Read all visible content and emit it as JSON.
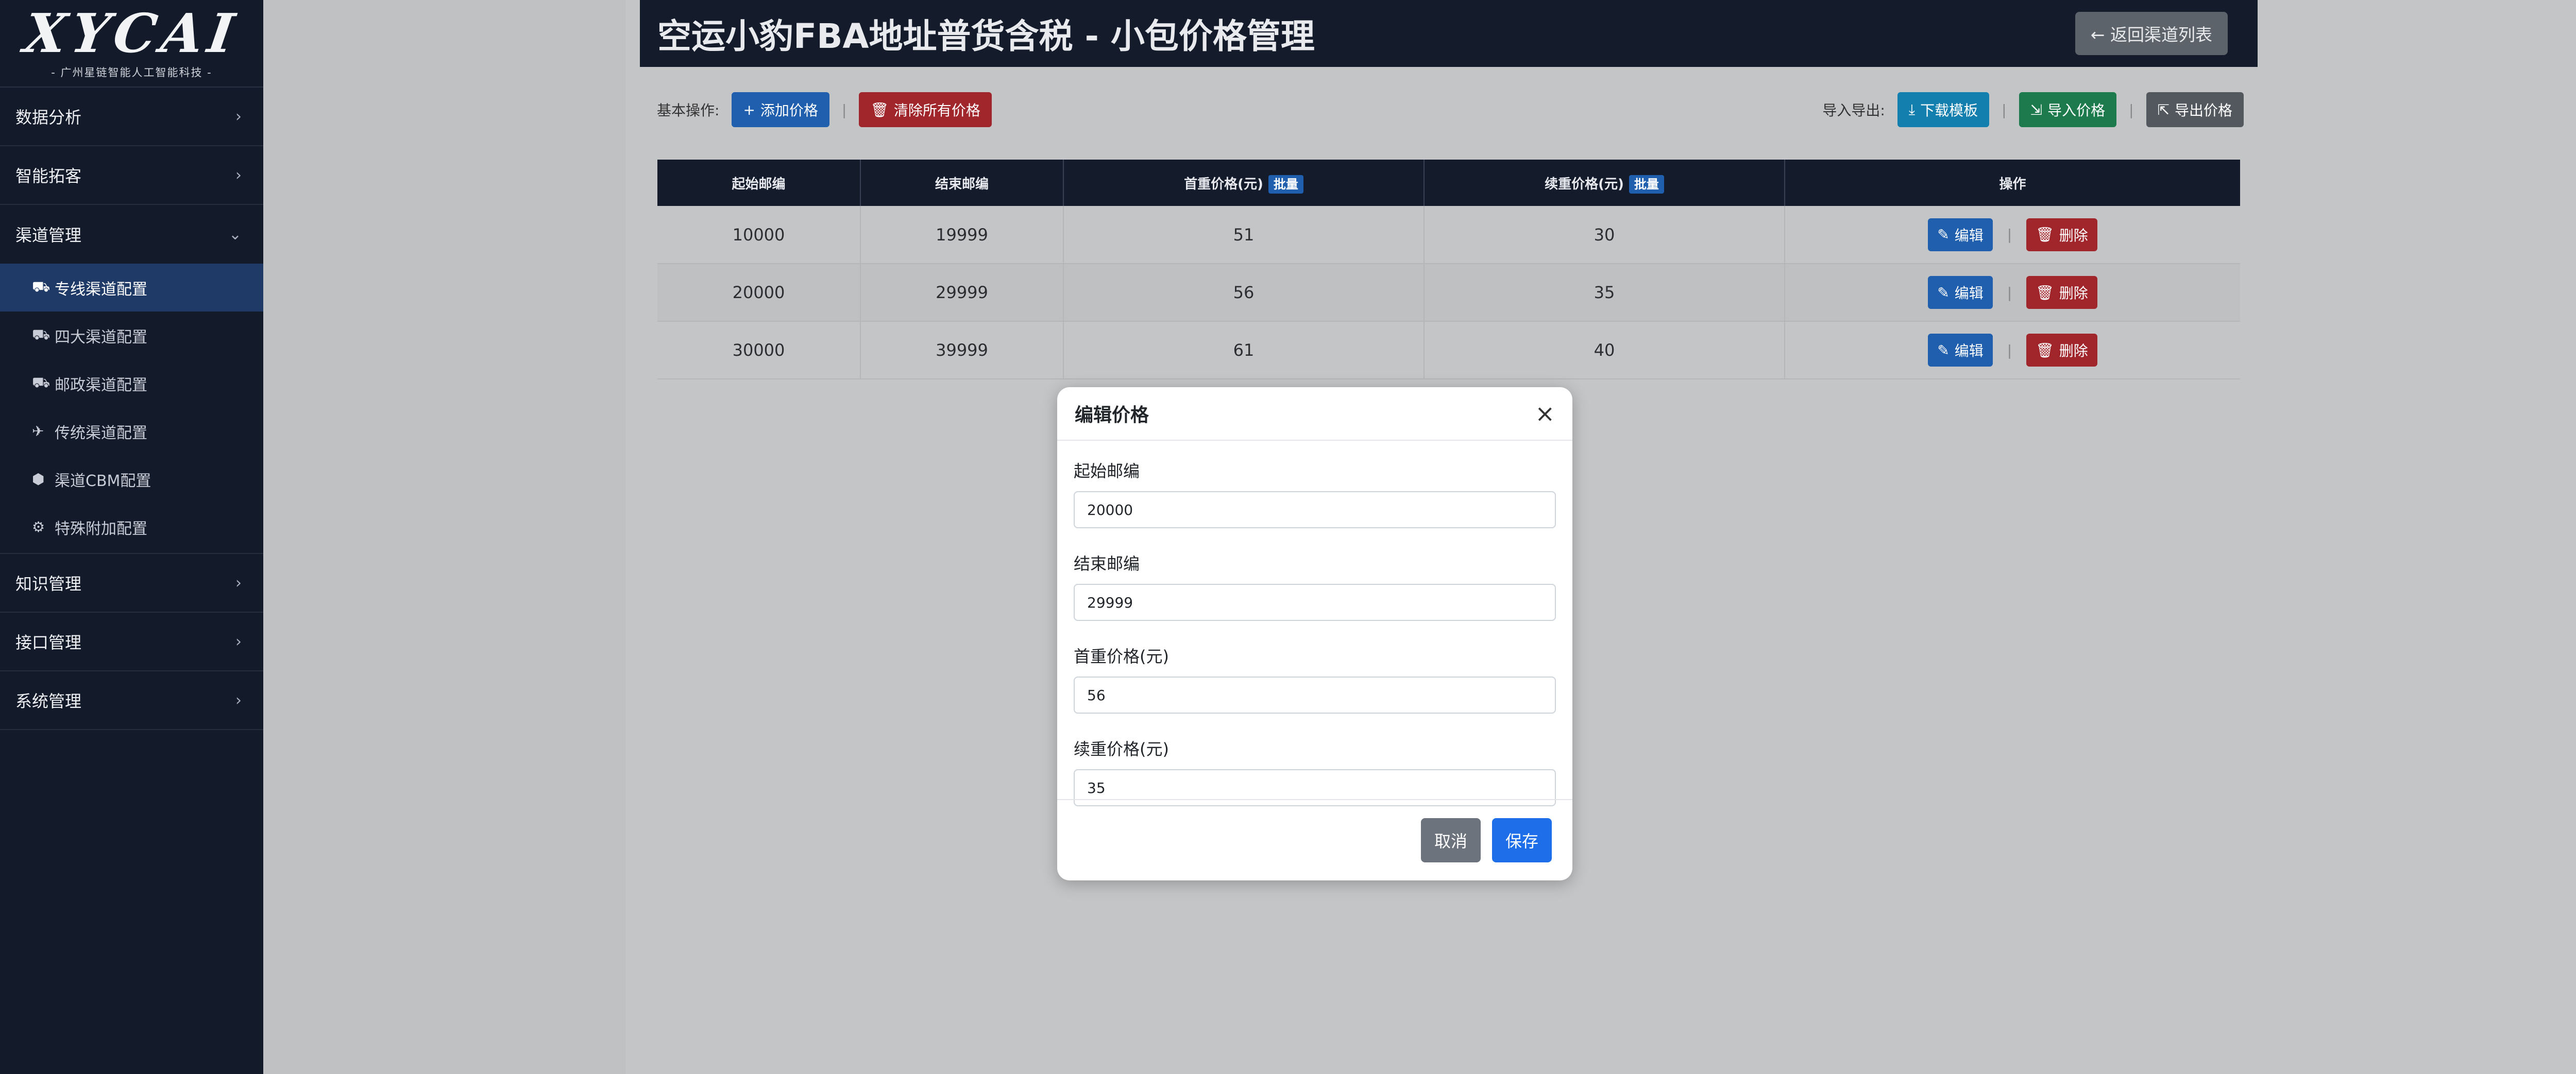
{
  "sidebar": {
    "logo": "XYCAI",
    "logo_sub": "- 广州星链智能人工智能科技 -",
    "items": [
      {
        "label": "数据分析"
      },
      {
        "label": "智能拓客"
      },
      {
        "label": "渠道管理"
      },
      {
        "label": "知识管理"
      },
      {
        "label": "接口管理"
      },
      {
        "label": "系统管理"
      }
    ],
    "sub_items": [
      {
        "label": "专线渠道配置",
        "icon": "truck-icon"
      },
      {
        "label": "四大渠道配置",
        "icon": "truck-icon"
      },
      {
        "label": "邮政渠道配置",
        "icon": "truck-icon"
      },
      {
        "label": "传统渠道配置",
        "icon": "plane-icon"
      },
      {
        "label": "渠道CBM配置",
        "icon": "box-icon"
      },
      {
        "label": "特殊附加配置",
        "icon": "gear-icon"
      }
    ]
  },
  "header": {
    "title": "空运小豹FBA地址普货含税 - 小包价格管理",
    "back_label": "返回渠道列表"
  },
  "toolbar": {
    "basic_label": "基本操作:",
    "add_label": "添加价格",
    "clear_label": "清除所有价格",
    "io_label": "导入导出:",
    "download_label": "下载模板",
    "import_label": "导入价格",
    "export_label": "导出价格"
  },
  "table": {
    "columns": [
      "起始邮编",
      "结束邮编",
      "首重价格(元)",
      "续重价格(元)",
      "操作"
    ],
    "batch_label": "批量",
    "edit_label": "编辑",
    "delete_label": "删除",
    "rows": [
      {
        "start": "10000",
        "end": "19999",
        "first": "51",
        "extra": "30"
      },
      {
        "start": "20000",
        "end": "29999",
        "first": "56",
        "extra": "35"
      },
      {
        "start": "30000",
        "end": "39999",
        "first": "61",
        "extra": "40"
      }
    ]
  },
  "modal": {
    "title": "编辑价格",
    "close": "×",
    "fields": [
      {
        "label": "起始邮编",
        "value": "20000"
      },
      {
        "label": "结束邮编",
        "value": "29999"
      },
      {
        "label": "首重价格(元)",
        "value": "56"
      },
      {
        "label": "续重价格(元)",
        "value": "35"
      }
    ],
    "cancel_label": "取消",
    "save_label": "保存"
  }
}
